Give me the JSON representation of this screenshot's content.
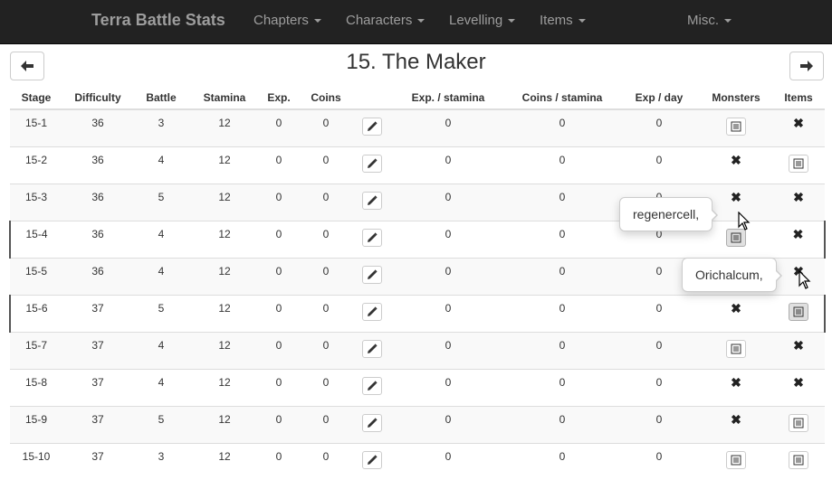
{
  "navbar": {
    "brand": "Terra Battle Stats",
    "menus": [
      "Chapters",
      "Characters",
      "Levelling",
      "Items"
    ],
    "misc": "Misc."
  },
  "page": {
    "title": "15. The Maker",
    "prev_icon": "arrow-left-icon",
    "next_icon": "arrow-right-icon"
  },
  "table": {
    "headers": [
      "Stage",
      "Difficulty",
      "Battle",
      "Stamina",
      "Exp.",
      "Coins",
      "",
      "Exp. / stamina",
      "Coins / stamina",
      "Exp / day",
      "Monsters",
      "Items"
    ],
    "rows": [
      {
        "stage": "15-1",
        "difficulty": "36",
        "battle": "3",
        "stamina": "12",
        "exp": "0",
        "coins": "0",
        "exp_per_stamina": "0",
        "coins_per_stamina": "0",
        "exp_per_day": "0",
        "monsters": "list",
        "items": "none"
      },
      {
        "stage": "15-2",
        "difficulty": "36",
        "battle": "4",
        "stamina": "12",
        "exp": "0",
        "coins": "0",
        "exp_per_stamina": "0",
        "coins_per_stamina": "0",
        "exp_per_day": "0",
        "monsters": "none",
        "items": "list"
      },
      {
        "stage": "15-3",
        "difficulty": "36",
        "battle": "5",
        "stamina": "12",
        "exp": "0",
        "coins": "0",
        "exp_per_stamina": "0",
        "coins_per_stamina": "0",
        "exp_per_day": "0",
        "monsters": "none",
        "items": "none"
      },
      {
        "stage": "15-4",
        "difficulty": "36",
        "battle": "4",
        "stamina": "12",
        "exp": "0",
        "coins": "0",
        "exp_per_stamina": "0",
        "coins_per_stamina": "0",
        "exp_per_day": "0",
        "monsters": "list",
        "items": "none"
      },
      {
        "stage": "15-5",
        "difficulty": "36",
        "battle": "4",
        "stamina": "12",
        "exp": "0",
        "coins": "0",
        "exp_per_stamina": "0",
        "coins_per_stamina": "0",
        "exp_per_day": "0",
        "monsters": "none",
        "items": "none"
      },
      {
        "stage": "15-6",
        "difficulty": "37",
        "battle": "5",
        "stamina": "12",
        "exp": "0",
        "coins": "0",
        "exp_per_stamina": "0",
        "coins_per_stamina": "0",
        "exp_per_day": "0",
        "monsters": "none",
        "items": "list"
      },
      {
        "stage": "15-7",
        "difficulty": "37",
        "battle": "4",
        "stamina": "12",
        "exp": "0",
        "coins": "0",
        "exp_per_stamina": "0",
        "coins_per_stamina": "0",
        "exp_per_day": "0",
        "monsters": "list",
        "items": "none"
      },
      {
        "stage": "15-8",
        "difficulty": "37",
        "battle": "4",
        "stamina": "12",
        "exp": "0",
        "coins": "0",
        "exp_per_stamina": "0",
        "coins_per_stamina": "0",
        "exp_per_day": "0",
        "monsters": "none",
        "items": "none"
      },
      {
        "stage": "15-9",
        "difficulty": "37",
        "battle": "5",
        "stamina": "12",
        "exp": "0",
        "coins": "0",
        "exp_per_stamina": "0",
        "coins_per_stamina": "0",
        "exp_per_day": "0",
        "monsters": "none",
        "items": "list"
      },
      {
        "stage": "15-10",
        "difficulty": "37",
        "battle": "3",
        "stamina": "12",
        "exp": "0",
        "coins": "0",
        "exp_per_stamina": "0",
        "coins_per_stamina": "0",
        "exp_per_day": "0",
        "monsters": "list",
        "items": "list"
      }
    ]
  },
  "popovers": {
    "monsters_15_4": "regenercell,",
    "items_15_6": "Orichalcum,"
  },
  "icons": {
    "edit": "pencil-icon",
    "list": "list-icon",
    "none": "remove-icon"
  }
}
